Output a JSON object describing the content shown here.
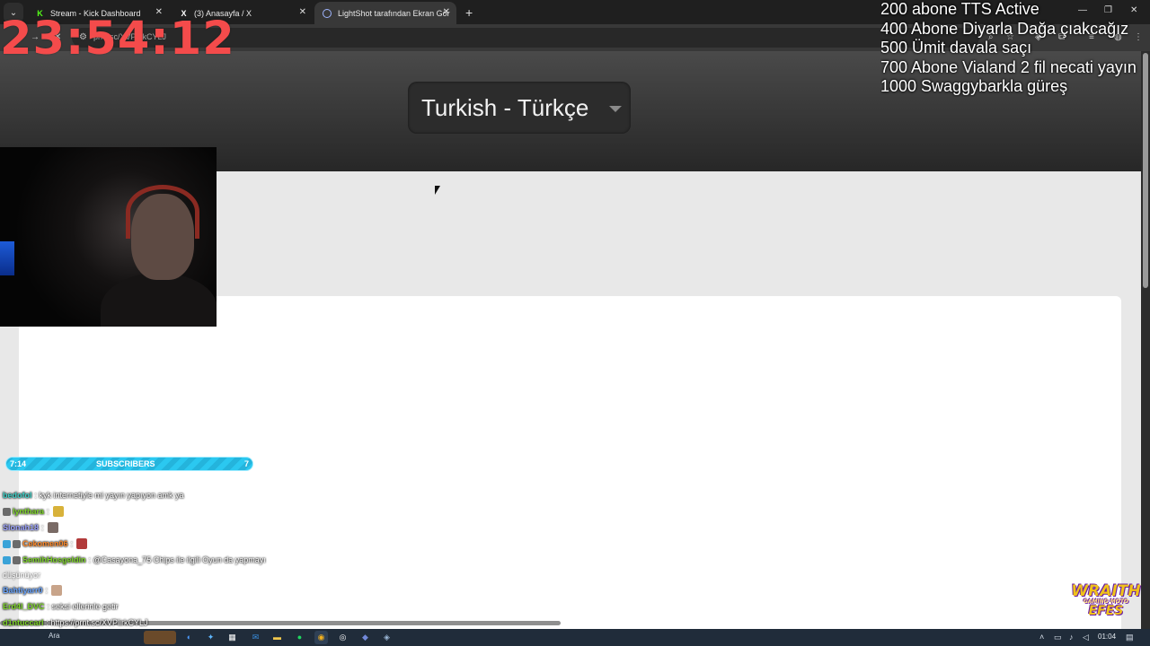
{
  "browser": {
    "tabs": [
      {
        "title": "Stream - Kick Dashboard",
        "favicon": "kick-icon",
        "active": false
      },
      {
        "title": "(3) Anasayfa / X",
        "favicon": "x-icon",
        "active": false
      },
      {
        "title": "LightShot tarafından Ekran Gör",
        "favicon": "lightshot-icon",
        "active": true
      }
    ],
    "new_tab_symbol": "+",
    "tab_menu_symbol": "⌄",
    "url": "prnt.sc/XVPlirkCYLJ",
    "window_controls": [
      "—",
      "❐",
      "✕"
    ]
  },
  "page": {
    "language_select": "Turkish - Türkçe"
  },
  "overlay": {
    "timer": "23:54:12",
    "goals": [
      "200 abone TTS Active",
      "400 Abone Diyarla Dağa çıakcağız",
      "500 Ümit davala saçı",
      "700 Abone Vialand 2 fil necati yayın",
      "1000 Swaggybarkla güreş"
    ],
    "subscribers": {
      "left": "7:14",
      "label": "SUBSCRIBERS",
      "right": "7"
    },
    "chat": [
      {
        "user": "bedofol",
        "color": "#3fd1c8",
        "badges": [],
        "text": ": kyk internetiyle mi yayın yapıyon amk ya",
        "emote": null
      },
      {
        "user": "lynthara",
        "color": "#7fd62a",
        "badges": [
          "op"
        ],
        "text": ":",
        "emote": "#d8b23a"
      },
      {
        "user": "Slonah18",
        "color": "#9da4ff",
        "badges": [],
        "text": ":",
        "emote": "#7a6b66"
      },
      {
        "user": "Cekomen06",
        "color": "#ff8a2a",
        "badges": [
          "sub",
          "op"
        ],
        "text": ":",
        "emote": "#b23a3a"
      },
      {
        "user": "SemihHosgeldin",
        "color": "#7fd62a",
        "badges": [
          "sub",
          "op"
        ],
        "text": ": @Casayona_75 Chips ile ilgili Oyun da yapmayı",
        "emote": null
      },
      {
        "user": "",
        "color": "#ffffff",
        "badges": [],
        "text": "düşünüyor",
        "emote": null
      },
      {
        "user": "Bahtiyarr0",
        "color": "#6ba6ff",
        "badges": [],
        "text": ":",
        "emote": "#c8a48a"
      },
      {
        "user": "Erd4l_DVC",
        "color": "#7fd62a",
        "badges": [],
        "text": ": seksi ellerinle getir",
        "emote": null
      },
      {
        "user": "d1ntuccarl",
        "color": "#7fd62a",
        "badges": [],
        "text": ": https://prnt.sc/XVPlirkCYLJ",
        "emote": null
      }
    ],
    "wraith_logo": [
      "WRAITH",
      "GAMING MOTO",
      "EFES"
    ]
  },
  "taskbar": {
    "search_placeholder": "Ara",
    "apps": [
      "chrome-icon",
      "edge-icon",
      "calculator-icon",
      "outlook-icon",
      "explorer-icon",
      "spotify-icon",
      "chrome-active-icon",
      "obs-icon",
      "discord-icon",
      "steam-icon"
    ],
    "clock": "01:04"
  },
  "colors": {
    "timer": "#f44b4b",
    "subbar": "#2bc8f0",
    "taskbar": "#202c3a",
    "page_header": "#2c2c2c"
  }
}
